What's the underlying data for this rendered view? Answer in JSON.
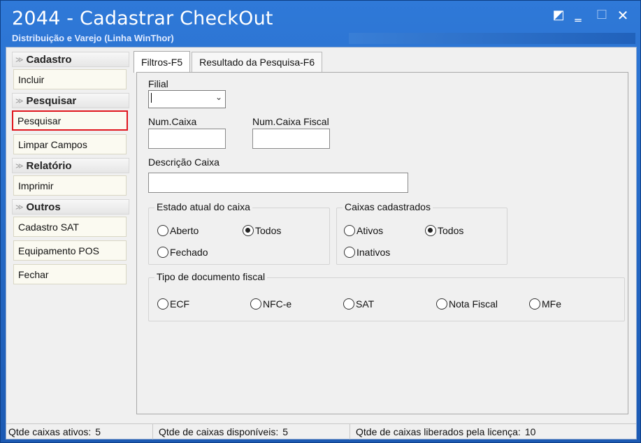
{
  "window": {
    "title": "2044 - Cadastrar CheckOut",
    "subtitle": "Distribuição e Varejo (Linha WinThor)",
    "controls": {
      "restore": "◩",
      "minimize": "‗",
      "maximize": "☐",
      "close": "✕"
    }
  },
  "sidebar": {
    "groups": [
      {
        "title": "Cadastro",
        "items": [
          "Incluir"
        ]
      },
      {
        "title": "Pesquisar",
        "items": [
          "Pesquisar",
          "Limpar Campos"
        ]
      },
      {
        "title": "Relatório",
        "items": [
          "Imprimir"
        ]
      },
      {
        "title": "Outros",
        "items": [
          "Cadastro SAT",
          "Equipamento POS",
          "Fechar"
        ]
      }
    ],
    "active_item": "Pesquisar",
    "chevron_icon": "double-chevron-icon"
  },
  "tabs": [
    {
      "label": "Filtros-F5",
      "active": true
    },
    {
      "label": "Resultado da Pesquisa-F6",
      "active": false
    }
  ],
  "form": {
    "filial_label": "Filial",
    "filial_value": "",
    "num_caixa_label": "Num.Caixa",
    "num_caixa_value": "",
    "num_caixa_fiscal_label": "Num.Caixa Fiscal",
    "num_caixa_fiscal_value": "",
    "descricao_label": "Descrição Caixa",
    "descricao_value": ""
  },
  "estado_group": {
    "title": "Estado atual do caixa",
    "options": [
      "Aberto",
      "Todos",
      "Fechado"
    ],
    "selected": "Todos"
  },
  "caixas_group": {
    "title": "Caixas cadastrados",
    "options": [
      "Ativos",
      "Todos",
      "Inativos"
    ],
    "selected": "Todos"
  },
  "tipo_group": {
    "title": "Tipo de documento fiscal",
    "options": [
      "ECF",
      "NFC-e",
      "SAT",
      "Nota Fiscal",
      "MFe"
    ],
    "selected": ""
  },
  "status": {
    "ativos_label": "Qtde caixas ativos:",
    "ativos_value": "5",
    "disponiveis_label": "Qtde de caixas disponíveis:",
    "disponiveis_value": "5",
    "liberados_label": "Qtde de caixas liberados pela licença:",
    "liberados_value": "10"
  },
  "colors": {
    "titlebar": "#1f5fb8",
    "highlight": "#e0161e"
  }
}
